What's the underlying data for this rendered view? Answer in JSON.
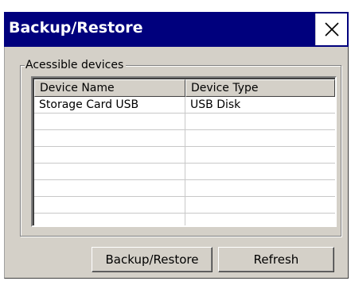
{
  "window": {
    "title": "Backup/Restore",
    "close_icon": "close-x-icon"
  },
  "group": {
    "legend": "Acessible devices"
  },
  "table": {
    "columns": [
      "Device Name",
      "Device Type"
    ],
    "rows": [
      [
        "Storage Card USB",
        "USB Disk"
      ],
      [
        "",
        ""
      ],
      [
        "",
        ""
      ],
      [
        "",
        ""
      ],
      [
        "",
        ""
      ],
      [
        "",
        ""
      ],
      [
        "",
        ""
      ],
      [
        "",
        ""
      ]
    ]
  },
  "buttons": {
    "backup_restore": "Backup/Restore",
    "refresh": "Refresh"
  },
  "colors": {
    "titlebar": "#00007d",
    "dialog_face": "#d4d0c8",
    "title_text": "#ffffff"
  }
}
